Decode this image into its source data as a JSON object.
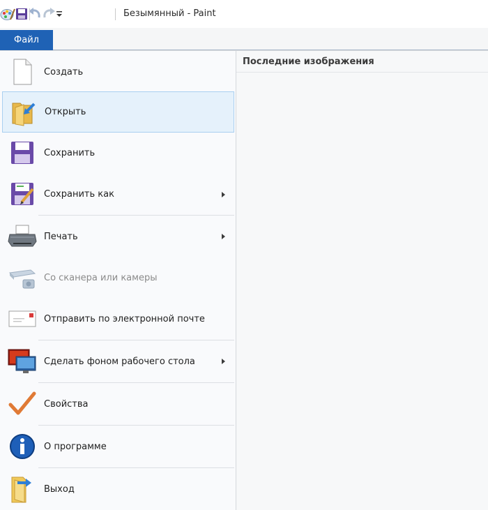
{
  "window": {
    "title": "Безымянный - Paint"
  },
  "quick_access": {
    "items": [
      {
        "name": "paint-app-icon"
      },
      {
        "name": "save-icon"
      },
      {
        "name": "undo-icon"
      },
      {
        "name": "redo-icon"
      },
      {
        "name": "customize-dropdown-icon"
      }
    ]
  },
  "ribbon": {
    "file_tab": "Файл"
  },
  "file_menu": {
    "items": [
      {
        "label": "Создать",
        "icon": "new-document-icon"
      },
      {
        "label": "Открыть",
        "icon": "open-folder-icon",
        "state": "hover"
      },
      {
        "label": "Сохранить",
        "icon": "save-disk-icon"
      },
      {
        "label": "Сохранить как",
        "icon": "save-as-icon",
        "submenu": true
      },
      {
        "label": "Печать",
        "icon": "printer-icon",
        "submenu": true
      },
      {
        "label": "Со сканера или камеры",
        "icon": "scanner-camera-icon",
        "state": "disabled"
      },
      {
        "label": "Отправить по электронной почте",
        "icon": "email-envelope-icon"
      },
      {
        "label": "Сделать фоном рабочего стола",
        "icon": "desktop-background-icon",
        "submenu": true
      },
      {
        "label": "Свойства",
        "icon": "checkmark-icon"
      },
      {
        "label": "О программе",
        "icon": "info-icon"
      },
      {
        "label": "Выход",
        "icon": "exit-icon"
      }
    ]
  },
  "recent_panel": {
    "heading": "Последние изображения"
  },
  "colors": {
    "file_tab_bg": "#1f62b5",
    "hover_bg": "#e5f1fb",
    "hover_border": "#a9cff0",
    "menu_bg": "#f9fafc"
  }
}
